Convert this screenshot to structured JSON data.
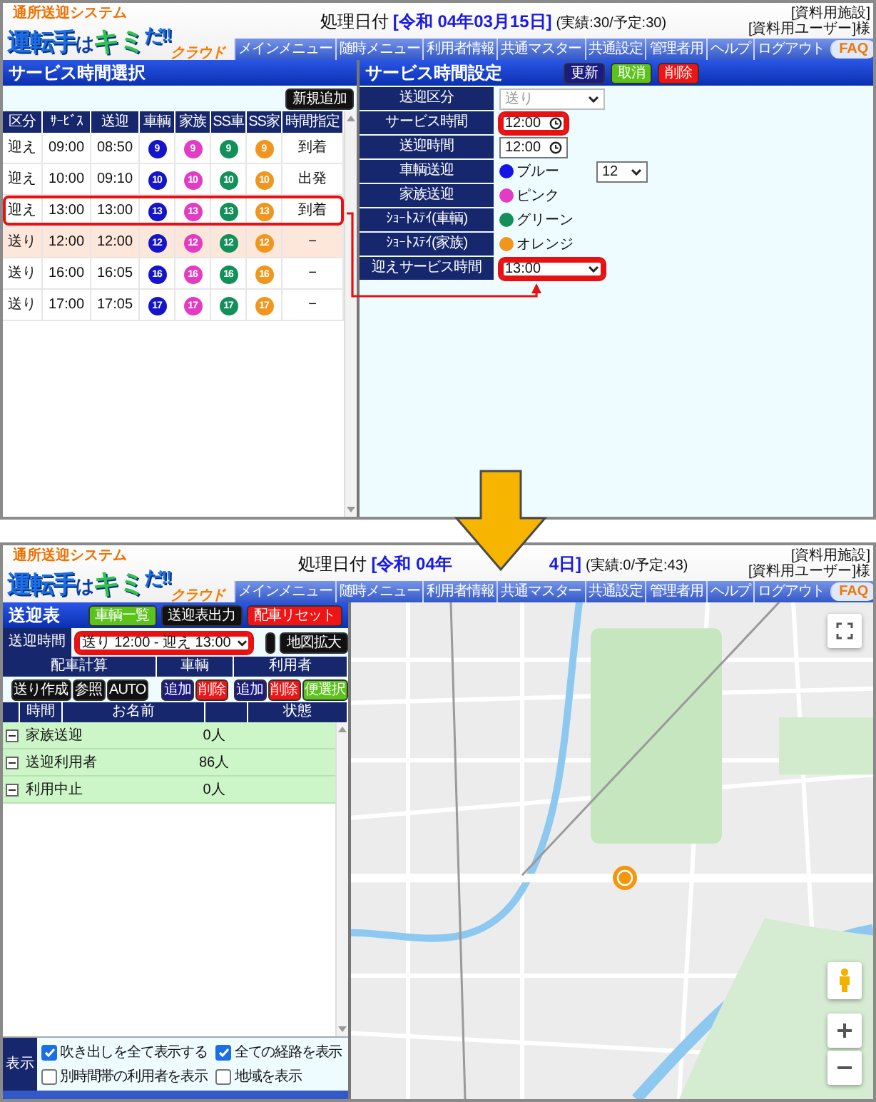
{
  "screens": [
    {
      "kind": "service_time",
      "annotation_arrow": true,
      "header": {
        "logo": {
          "tagline": "通所送迎システム",
          "parts": [
            {
              "kind": "kanji",
              "text": "運転手"
            },
            {
              "kind": "kana",
              "text": "は"
            },
            {
              "kind": "accent",
              "text": "キミ"
            },
            {
              "kind": "exclaim",
              "text": "だ!!"
            },
            {
              "kind": "badge",
              "text": "クラウド"
            }
          ]
        },
        "date_label": "処理日付",
        "date_parts": [
          "[令和 04年03月15日]"
        ],
        "counts": "(実績:30/予定:30)",
        "facility": "[資料用施設]",
        "user": "[資料用ユーザー]様",
        "nav": [
          "メインメニュー",
          "随時メニュー",
          "利用者情報",
          "共通マスター",
          "共通設定",
          "管理者用",
          "ヘルプ",
          "ログアウト"
        ],
        "faq": "FAQ"
      },
      "left_panel": {
        "title": "サービス時間選択",
        "new_button": "新規追加",
        "columns": [
          {
            "label": "区分"
          },
          {
            "label": "ｻｰﾋﾞｽ"
          },
          {
            "label": "送迎"
          },
          {
            "label": "車輌",
            "color": "#1414c8"
          },
          {
            "label": "家族",
            "color": "#e33cc4"
          },
          {
            "label": "SS車",
            "color": "#12905a"
          },
          {
            "label": "SS家",
            "color": "#f0961e"
          },
          {
            "label": "時間指定"
          }
        ],
        "rows": [
          {
            "cells": [
              "迎え",
              "09:00",
              "08:50",
              "9",
              "9",
              "9",
              "9",
              "到着"
            ],
            "selected": false,
            "highlighted": false
          },
          {
            "cells": [
              "迎え",
              "10:00",
              "09:10",
              "10",
              "10",
              "10",
              "10",
              "出発"
            ],
            "selected": false,
            "highlighted": false
          },
          {
            "cells": [
              "迎え",
              "13:00",
              "13:00",
              "13",
              "13",
              "13",
              "13",
              "到着"
            ],
            "selected": false,
            "highlighted": true
          },
          {
            "cells": [
              "送り",
              "12:00",
              "12:00",
              "12",
              "12",
              "12",
              "12",
              "−"
            ],
            "selected": true,
            "highlighted": false
          },
          {
            "cells": [
              "送り",
              "16:00",
              "16:05",
              "16",
              "16",
              "16",
              "16",
              "−"
            ],
            "selected": false,
            "highlighted": false
          },
          {
            "cells": [
              "送り",
              "17:00",
              "17:05",
              "17",
              "17",
              "17",
              "17",
              "−"
            ],
            "selected": false,
            "highlighted": false
          }
        ]
      },
      "right_panel": {
        "title": "サービス時間設定",
        "buttons": [
          {
            "label": "更新",
            "kind": "primary"
          },
          {
            "label": "取消",
            "kind": "success"
          },
          {
            "label": "削除",
            "kind": "danger"
          }
        ],
        "fields": [
          {
            "label": "送迎区分",
            "kind": "select",
            "value": "送り",
            "disabled": true,
            "highlighted": false
          },
          {
            "label": "サービス時間",
            "kind": "time",
            "value": "12:00",
            "disabled": false,
            "highlighted": true
          },
          {
            "label": "送迎時間",
            "kind": "time",
            "value": "12:00",
            "disabled": false,
            "highlighted": false
          },
          {
            "label": "車輌送迎",
            "kind": "color",
            "color": "#1414e6",
            "value": "ブルー",
            "extra_select": "12"
          },
          {
            "label": "家族送迎",
            "kind": "color",
            "color": "#e33cc4",
            "value": "ピンク"
          },
          {
            "label": "ｼｮｰﾄｽﾃｲ(車輌)",
            "kind": "color",
            "color": "#12905a",
            "value": "グリーン"
          },
          {
            "label": "ｼｮｰﾄｽﾃｲ(家族)",
            "kind": "color",
            "color": "#f0961e",
            "value": "オレンジ"
          },
          {
            "label": "迎えサービス時間",
            "kind": "select",
            "value": "13:00",
            "disabled": false,
            "highlighted": true
          }
        ]
      }
    },
    {
      "kind": "route_table",
      "annotation_arrow": false,
      "header": {
        "logo": {
          "tagline": "通所送迎システム",
          "parts": [
            {
              "kind": "kanji",
              "text": "運転手"
            },
            {
              "kind": "kana",
              "text": "は"
            },
            {
              "kind": "accent",
              "text": "キミ"
            },
            {
              "kind": "exclaim",
              "text": "だ!!"
            },
            {
              "kind": "badge",
              "text": "クラウド"
            }
          ]
        },
        "date_label": "処理日付",
        "date_parts": [
          "[令和 04年",
          "4日]"
        ],
        "counts": "(実績:0/予定:43)",
        "facility": "[資料用施設]",
        "user": "[資料用ユーザー]様",
        "nav": [
          "メインメニュー",
          "随時メニュー",
          "利用者情報",
          "共通マスター",
          "共通設定",
          "管理者用",
          "ヘルプ",
          "ログアウト"
        ],
        "faq": "FAQ"
      },
      "left_panel": {
        "title": "送迎表",
        "buttons": [
          {
            "label": "車輌一覧",
            "kind": "success"
          },
          {
            "label": "送迎表出力",
            "kind": "dark"
          },
          {
            "label": "配車リセット",
            "kind": "danger"
          }
        ],
        "time_label": "送迎時間",
        "time_select": {
          "value": "送り 12:00 - 迎え 13:00",
          "highlighted": true
        },
        "map_button": "地図拡大",
        "groups": [
          {
            "label": "配車計算",
            "buttons": [
              {
                "label": "送り作成",
                "kind": "dark"
              },
              {
                "label": "参照",
                "kind": "dark"
              },
              {
                "label": "AUTO",
                "kind": "dark"
              }
            ]
          },
          {
            "label": "車輌",
            "buttons": [
              {
                "label": "追加",
                "kind": "primary"
              },
              {
                "label": "削除",
                "kind": "danger"
              }
            ]
          },
          {
            "label": "利用者",
            "buttons": [
              {
                "label": "追加",
                "kind": "primary"
              },
              {
                "label": "削除",
                "kind": "danger"
              },
              {
                "label": "便選択",
                "kind": "success"
              }
            ]
          }
        ],
        "columns": [
          {
            "label": "時間"
          },
          {
            "label": "お名前"
          },
          {
            "label": "状態"
          }
        ],
        "rows": [
          {
            "name": "家族送迎",
            "count": "0人",
            "expanded": true
          },
          {
            "name": "送迎利用者",
            "count": "86人",
            "expanded": true
          },
          {
            "name": "利用中止",
            "count": "0人",
            "expanded": true
          }
        ],
        "footer": {
          "label": "表示",
          "options": [
            {
              "label": "吹き出しを全て表示する",
              "checked": true
            },
            {
              "label": "全ての経路を表示",
              "checked": true
            },
            {
              "label": "別時間帯の利用者を表示",
              "checked": false
            },
            {
              "label": "地域を表示",
              "checked": false
            }
          ]
        }
      }
    }
  ]
}
